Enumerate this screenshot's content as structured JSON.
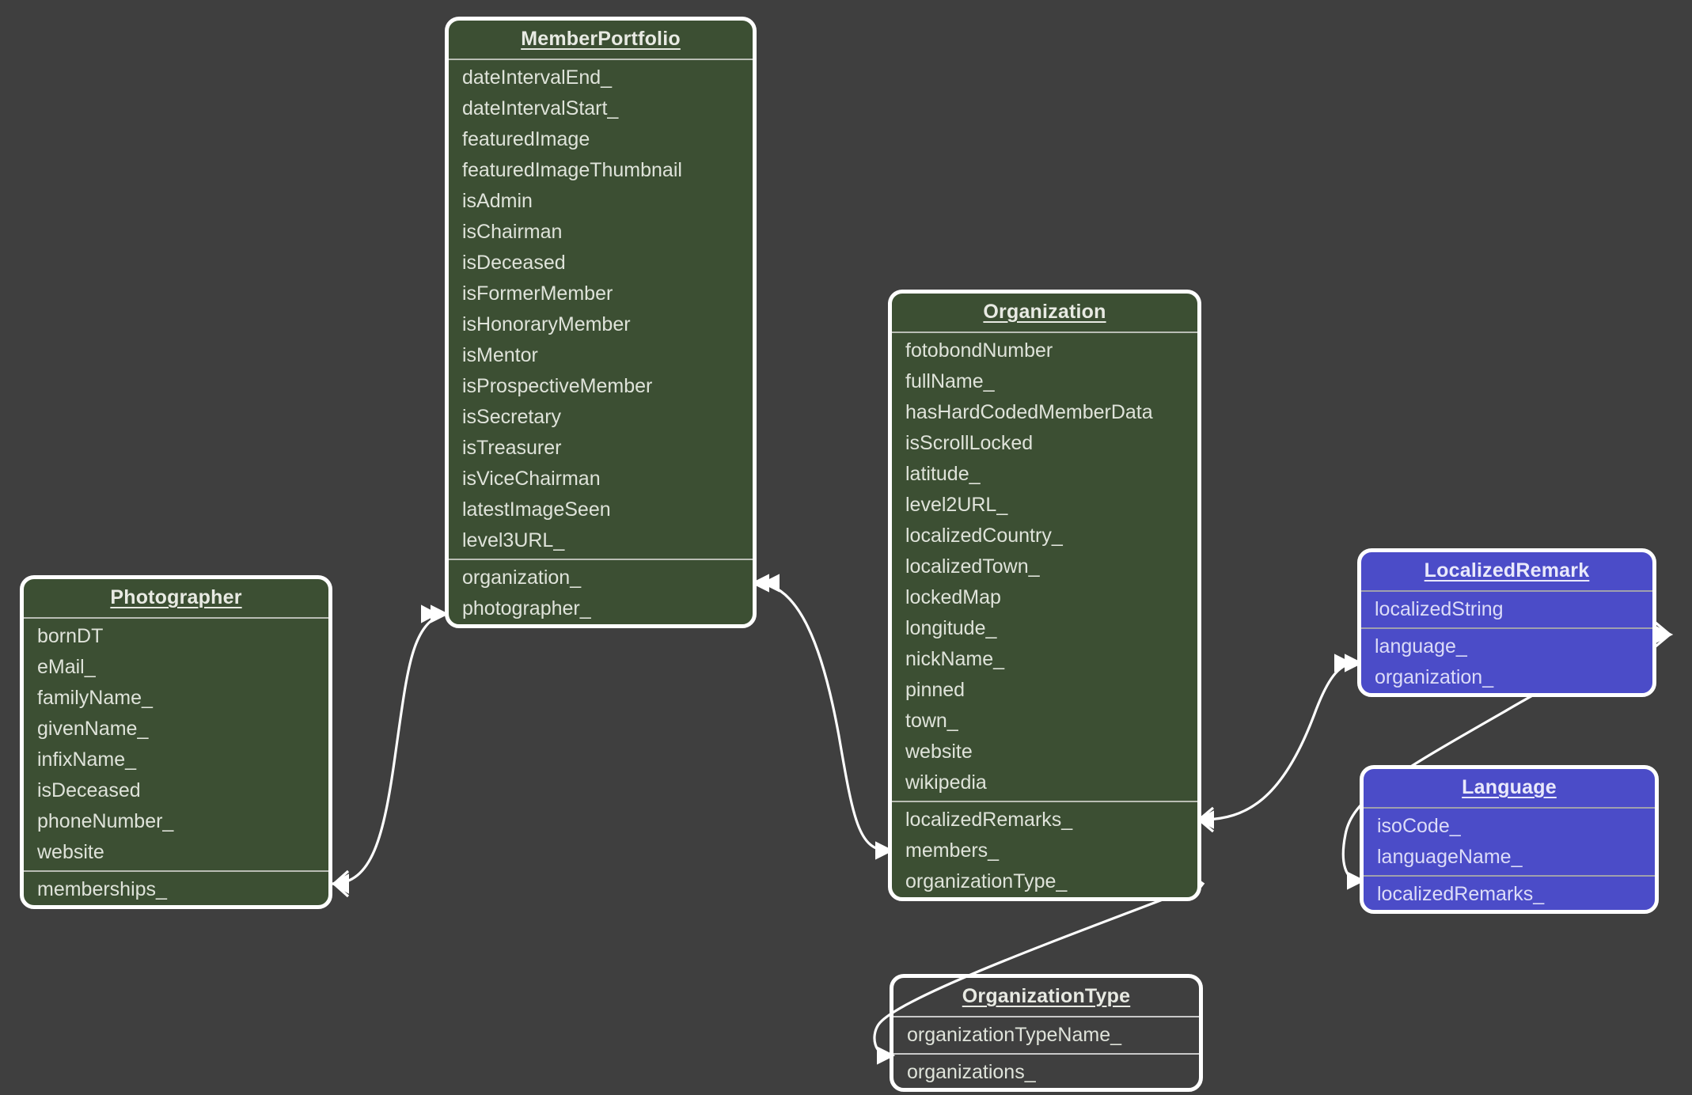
{
  "diagram": {
    "type": "entity-relationship-diagram",
    "background_color": "#3f3f3f",
    "palette": {
      "green_fill": "#3c4f33",
      "purple_fill": "#4b4cc8",
      "plain_fill": "transparent",
      "border": "#ffffff",
      "text": "#dfe3da",
      "divider": "#b9bdb4"
    },
    "entities": {
      "memberportfolio": {
        "title": "MemberPortfolio",
        "color": "green",
        "attributes": [
          "dateIntervalEnd_",
          "dateIntervalStart_",
          "featuredImage",
          "featuredImageThumbnail",
          "isAdmin",
          "isChairman",
          "isDeceased",
          "isFormerMember",
          "isHonoraryMember",
          "isMentor",
          "isProspectiveMember",
          "isSecretary",
          "isTreasurer",
          "isViceChairman",
          "latestImageSeen",
          "level3URL_"
        ],
        "relationships": [
          "organization_",
          "photographer_"
        ]
      },
      "photographer": {
        "title": "Photographer",
        "color": "green",
        "attributes": [
          "bornDT",
          "eMail_",
          "familyName_",
          "givenName_",
          "infixName_",
          "isDeceased",
          "phoneNumber_",
          "website"
        ],
        "relationships": [
          "memberships_"
        ]
      },
      "organization": {
        "title": "Organization",
        "color": "green",
        "attributes": [
          "fotobondNumber",
          "fullName_",
          "hasHardCodedMemberData",
          "isScrollLocked",
          "latitude_",
          "level2URL_",
          "localizedCountry_",
          "localizedTown_",
          "lockedMap",
          "longitude_",
          "nickName_",
          "pinned",
          "town_",
          "website",
          "wikipedia"
        ],
        "relationships": [
          "localizedRemarks_",
          "members_",
          "organizationType_"
        ]
      },
      "localizedremark": {
        "title": "LocalizedRemark",
        "color": "purple",
        "attributes": [
          "localizedString"
        ],
        "relationships": [
          "language_",
          "organization_"
        ]
      },
      "language": {
        "title": "Language",
        "color": "purple",
        "attributes": [
          "isoCode_",
          "languageName_"
        ],
        "relationships": [
          "localizedRemarks_"
        ]
      },
      "organizationtype": {
        "title": "OrganizationType",
        "color": "plain",
        "attributes": [
          "organizationTypeName_"
        ],
        "relationships": [
          "organizations_"
        ]
      }
    }
  }
}
